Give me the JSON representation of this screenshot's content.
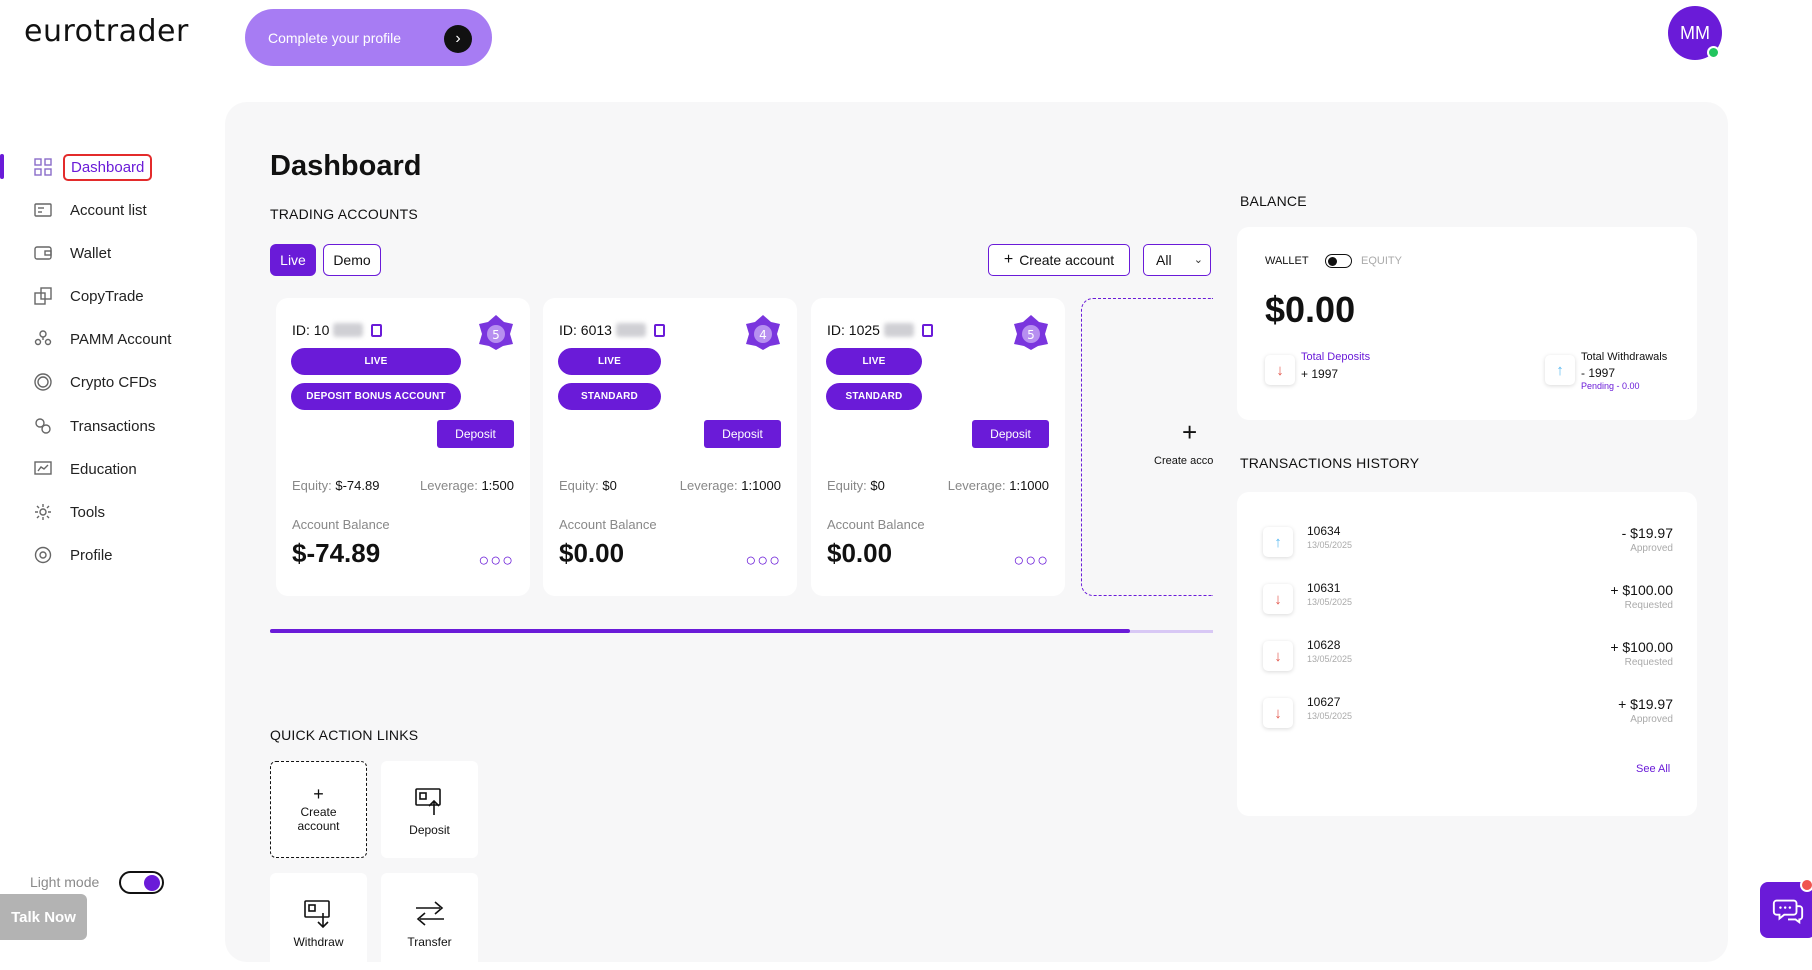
{
  "brand": {
    "logo": "eurotrader"
  },
  "header": {
    "profile_cta": "Complete your profile",
    "avatar_initials": "MM"
  },
  "sidebar": {
    "items": [
      {
        "label": "Dashboard",
        "icon": "grid-icon",
        "active": true
      },
      {
        "label": "Account list",
        "icon": "account-list-icon"
      },
      {
        "label": "Wallet",
        "icon": "wallet-icon"
      },
      {
        "label": "CopyTrade",
        "icon": "copy-icon"
      },
      {
        "label": "PAMM Account",
        "icon": "users-icon"
      },
      {
        "label": "Crypto CFDs",
        "icon": "coin-icon"
      },
      {
        "label": "Transactions",
        "icon": "transactions-icon"
      },
      {
        "label": "Education",
        "icon": "education-icon"
      },
      {
        "label": "Tools",
        "icon": "tools-icon"
      },
      {
        "label": "Profile",
        "icon": "gear-icon"
      }
    ],
    "mode_label": "Light mode",
    "talk_now": "Talk Now"
  },
  "main": {
    "title": "Dashboard",
    "trading_accounts_label": "TRADING ACCOUNTS",
    "tabs": {
      "live": "Live",
      "demo": "Demo"
    },
    "create_account": "Create account",
    "filter_value": "All",
    "accounts": [
      {
        "id": "ID: 10",
        "tier": "5",
        "pills": [
          "LIVE",
          "DEPOSIT BONUS ACCOUNT"
        ],
        "deposit": "Deposit",
        "equity_label": "Equity:",
        "equity": "$-74.89",
        "leverage_label": "Leverage:",
        "leverage": "1:500",
        "balance_label": "Account Balance",
        "balance": "$-74.89"
      },
      {
        "id": "ID: 6013",
        "tier": "4",
        "pills": [
          "LIVE",
          "STANDARD"
        ],
        "deposit": "Deposit",
        "equity_label": "Equity:",
        "equity": "$0",
        "leverage_label": "Leverage:",
        "leverage": "1:1000",
        "balance_label": "Account Balance",
        "balance": "$0.00"
      },
      {
        "id": "ID: 1025",
        "tier": "5",
        "pills": [
          "LIVE",
          "STANDARD"
        ],
        "deposit": "Deposit",
        "equity_label": "Equity:",
        "equity": "$0",
        "leverage_label": "Leverage:",
        "leverage": "1:1000",
        "balance_label": "Account Balance",
        "balance": "$0.00"
      }
    ],
    "new_account_text": "Create account",
    "quick_actions_label": "QUICK ACTION LINKS",
    "quick_actions": [
      {
        "label": "Create account",
        "icon": "plus-icon"
      },
      {
        "label": "Deposit",
        "icon": "deposit-icon"
      },
      {
        "label": "Withdraw",
        "icon": "withdraw-icon"
      },
      {
        "label": "Transfer",
        "icon": "transfer-icon"
      }
    ]
  },
  "balance": {
    "label": "BALANCE",
    "wallet": "WALLET",
    "equity": "EQUITY",
    "amount": "$0.00",
    "total_deposits_label": "Total Deposits",
    "total_deposits": "+ 1997",
    "total_withdrawals_label": "Total Withdrawals",
    "total_withdrawals": "- 1997",
    "pending": "Pending - 0.00"
  },
  "transactions": {
    "label": "TRANSACTIONS HISTORY",
    "rows": [
      {
        "id": "10634",
        "date": "13/05/2025",
        "amount": "- $19.97",
        "status": "Approved",
        "direction": "up"
      },
      {
        "id": "10631",
        "date": "13/05/2025",
        "amount": "+ $100.00",
        "status": "Requested",
        "direction": "down"
      },
      {
        "id": "10628",
        "date": "13/05/2025",
        "amount": "+ $100.00",
        "status": "Requested",
        "direction": "down"
      },
      {
        "id": "10627",
        "date": "13/05/2025",
        "amount": "+ $19.97",
        "status": "Approved",
        "direction": "down"
      }
    ],
    "see_all": "See All"
  },
  "colors": {
    "accent": "#6a1bd8",
    "cta": "#a77cf3",
    "online": "#22c55e",
    "down": "#e2574c",
    "up": "#58b8f2"
  }
}
